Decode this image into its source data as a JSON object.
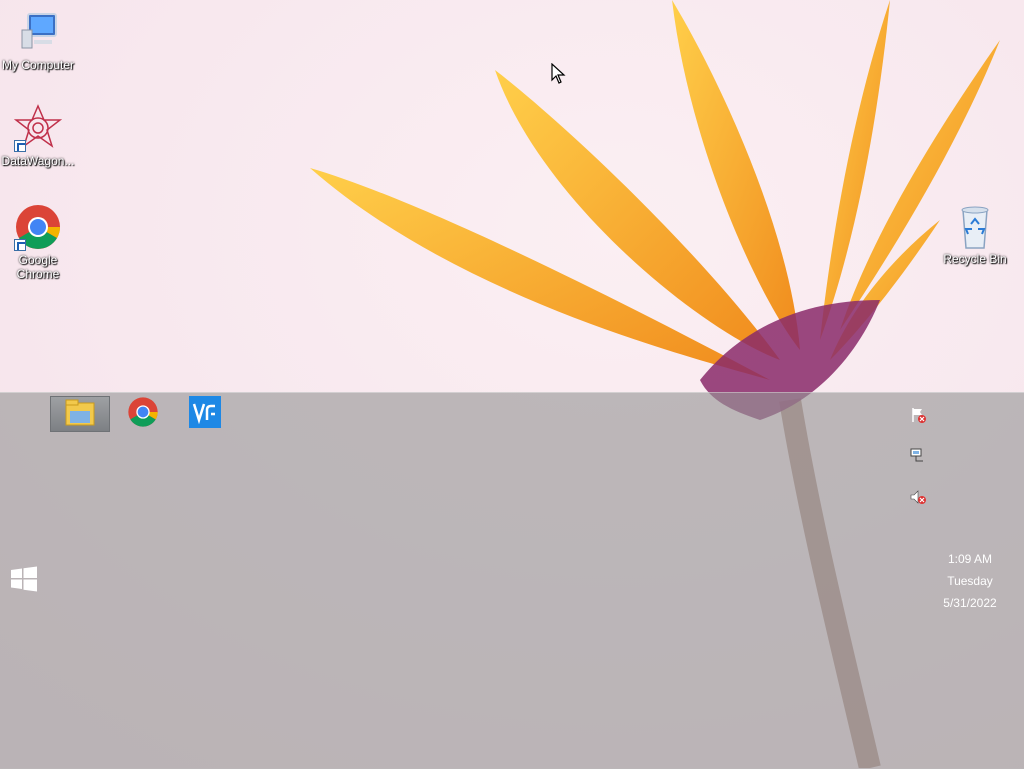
{
  "desktop": {
    "icons": [
      {
        "label": "My Computer",
        "icon": "my-computer-icon"
      },
      {
        "label": "DataWagon...",
        "icon": "datawagon-icon"
      },
      {
        "label": "Google Chrome",
        "icon": "chrome-icon"
      },
      {
        "label": "Recycle Bin",
        "icon": "recycle-bin-icon"
      }
    ]
  },
  "taskbar": {
    "pinned": [
      {
        "name": "File Explorer",
        "icon": "file-explorer-icon"
      },
      {
        "name": "Google Chrome",
        "icon": "chrome-icon"
      },
      {
        "name": "VNC Viewer",
        "icon": "vnc-icon"
      }
    ],
    "tray": {
      "icons": [
        "action-center-flag-icon",
        "network-icon",
        "volume-muted-icon"
      ]
    },
    "clock": {
      "time": "1:09 AM",
      "day": "Tuesday",
      "date": "5/31/2022"
    }
  },
  "colors": {
    "wallpaper_bg": "#f7e9ef",
    "petal": "#f5a623",
    "taskbar": "#969696",
    "chrome_red": "#db4437",
    "chrome_green": "#0f9d58",
    "chrome_yellow": "#f4b400",
    "chrome_blue": "#4285f4",
    "vnc_blue": "#1e88e5"
  }
}
